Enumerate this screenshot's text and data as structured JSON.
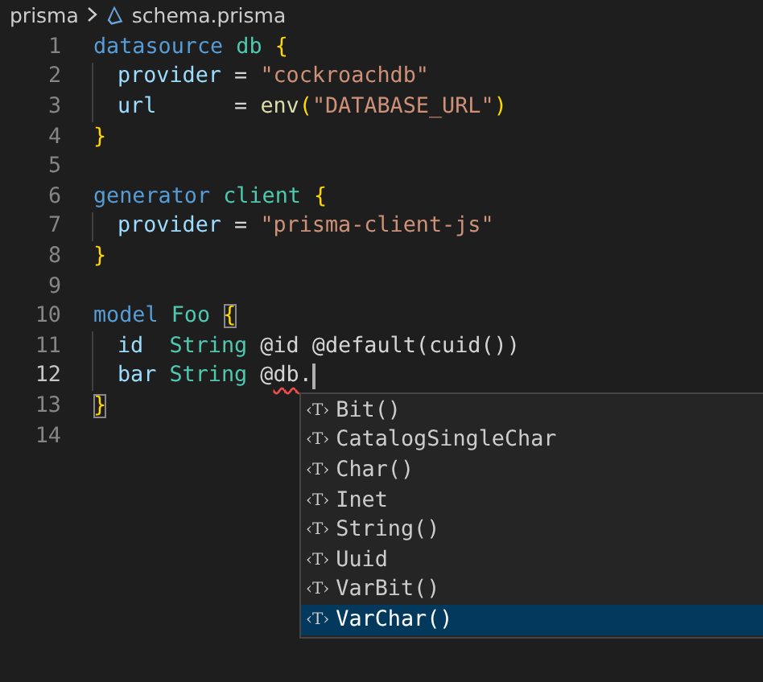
{
  "breadcrumb": {
    "folder": "prisma",
    "file": "schema.prisma"
  },
  "lines": [
    {
      "number": "1",
      "current": false,
      "indent": false,
      "tokens": [
        {
          "text": "datasource",
          "kind": "keyword"
        },
        {
          "text": " db",
          "kind": "name"
        },
        {
          "text": " {",
          "kind": "bracket"
        }
      ]
    },
    {
      "number": "2",
      "current": false,
      "indent": true,
      "tokens": [
        {
          "text": "provider",
          "kind": "property"
        },
        {
          "text": " = ",
          "kind": "plain"
        },
        {
          "text": "\"cockroachdb\"",
          "kind": "string"
        }
      ]
    },
    {
      "number": "3",
      "current": false,
      "indent": true,
      "tokens": [
        {
          "text": "url",
          "kind": "property"
        },
        {
          "text": "      = ",
          "kind": "plain"
        },
        {
          "text": "env",
          "kind": "function"
        },
        {
          "text": "(",
          "kind": "bracket"
        },
        {
          "text": "\"DATABASE_URL\"",
          "kind": "string"
        },
        {
          "text": ")",
          "kind": "bracket"
        }
      ]
    },
    {
      "number": "4",
      "current": false,
      "indent": false,
      "tokens": [
        {
          "text": "}",
          "kind": "bracket"
        }
      ]
    },
    {
      "number": "5",
      "current": false,
      "indent": false
    },
    {
      "number": "6",
      "current": false,
      "indent": false,
      "tokens": [
        {
          "text": "generator",
          "kind": "keyword"
        },
        {
          "text": " client",
          "kind": "name"
        },
        {
          "text": " {",
          "kind": "bracket"
        }
      ]
    },
    {
      "number": "7",
      "current": false,
      "indent": true,
      "tokens": [
        {
          "text": "provider",
          "kind": "property"
        },
        {
          "text": " = ",
          "kind": "plain"
        },
        {
          "text": "\"prisma-client-js\"",
          "kind": "string"
        }
      ]
    },
    {
      "number": "8",
      "current": false,
      "indent": false,
      "tokens": [
        {
          "text": "}",
          "kind": "bracket"
        }
      ]
    },
    {
      "number": "9",
      "current": false,
      "indent": false
    },
    {
      "number": "10",
      "current": false,
      "indent": false,
      "tokens": [
        {
          "text": "model",
          "kind": "keyword"
        },
        {
          "text": " Foo ",
          "kind": "name"
        },
        {
          "text": "{",
          "kind": "bracket-match"
        }
      ]
    },
    {
      "number": "11",
      "current": false,
      "indent": true,
      "tokens": [
        {
          "text": "id",
          "kind": "property"
        },
        {
          "text": "  String",
          "kind": "name"
        },
        {
          "text": " @id @default(cuid())",
          "kind": "plain"
        }
      ]
    },
    {
      "number": "12",
      "current": true,
      "indent": true,
      "tokens": [
        {
          "text": "bar",
          "kind": "property"
        },
        {
          "text": " String",
          "kind": "name"
        },
        {
          "text": " @",
          "kind": "plain"
        },
        {
          "text": "db",
          "kind": "error"
        },
        {
          "text": ".",
          "kind": "plain"
        }
      ]
    },
    {
      "number": "13",
      "current": false,
      "indent": false,
      "tokens": [
        {
          "text": "}",
          "kind": "bracket-match"
        }
      ]
    },
    {
      "number": "14",
      "current": false,
      "indent": false
    }
  ],
  "suggestions": [
    {
      "icon_text": "‹T›",
      "label": "Bit()",
      "selected": false
    },
    {
      "icon_text": "‹T›",
      "label": "CatalogSingleChar",
      "selected": false
    },
    {
      "icon_text": "‹T›",
      "label": "Char()",
      "selected": false
    },
    {
      "icon_text": "‹T›",
      "label": "Inet",
      "selected": false
    },
    {
      "icon_text": "‹T›",
      "label": "String()",
      "selected": false
    },
    {
      "icon_text": "‹T›",
      "label": "Uuid",
      "selected": false
    },
    {
      "icon_text": "‹T›",
      "label": "VarBit()",
      "selected": false
    },
    {
      "icon_text": "‹T›",
      "label": "VarChar()",
      "selected": true
    }
  ]
}
